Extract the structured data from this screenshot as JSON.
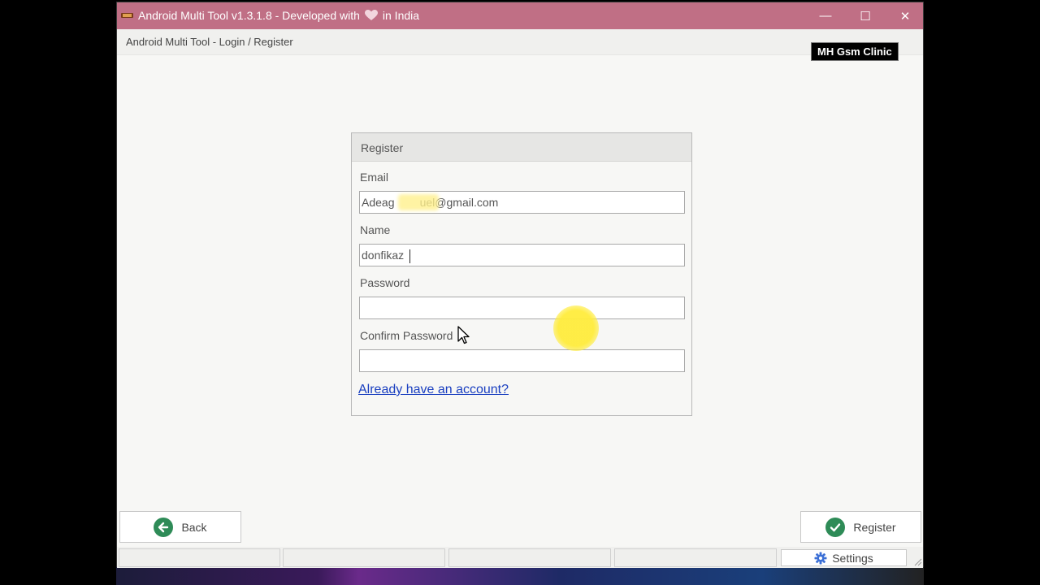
{
  "window": {
    "title_prefix": "Android Multi Tool v1.3.1.8 - Developed with",
    "title_suffix": "in India",
    "heart_icon": "heart-icon",
    "minimize_glyph": "—",
    "maximize_glyph": "☐",
    "close_glyph": "✕"
  },
  "header": {
    "breadcrumb": "Android Multi Tool - Login / Register"
  },
  "watermark": "MH Gsm Clinic",
  "register_form": {
    "heading": "Register",
    "email_label": "Email",
    "email_value": "Adeag        uel@gmail.com",
    "name_label": "Name",
    "name_value": "donfikaz",
    "password_label": "Password",
    "password_value": "",
    "confirm_password_label": "Confirm Password",
    "confirm_password_value": "",
    "login_link": "Already have an account?"
  },
  "buttons": {
    "back": "Back",
    "register": "Register",
    "settings": "Settings"
  },
  "colors": {
    "titlebar": "#c06f85",
    "accent_green": "#2e8b57",
    "link": "#1a3fc0",
    "settings_icon": "#3b6fd6"
  }
}
